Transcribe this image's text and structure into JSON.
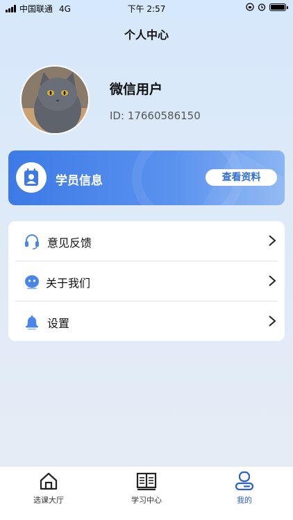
{
  "status_bar": {
    "carrier": "中国联通",
    "network": "4G",
    "time": "下午 2:57"
  },
  "header": {
    "title": "个人中心"
  },
  "profile": {
    "name": "微信用户",
    "id_text": "ID: 17660586150",
    "avatar_icon": "cat-photo"
  },
  "info_card": {
    "icon": "contact-card-icon",
    "title": "学员信息",
    "button_label": "查看资料",
    "accent": "#3d7ae6"
  },
  "menu": {
    "items": [
      {
        "icon": "headset-icon",
        "label": "意见反馈"
      },
      {
        "icon": "robot-face-icon",
        "label": "关于我们"
      },
      {
        "icon": "bell-icon",
        "label": "设置"
      }
    ]
  },
  "tab_bar": {
    "tabs": [
      {
        "icon": "house-icon",
        "label": "选课大厅",
        "active": false
      },
      {
        "icon": "book-icon",
        "label": "学习中心",
        "active": false
      },
      {
        "icon": "profile-icon",
        "label": "我的",
        "active": true
      }
    ],
    "active_color": "#2b5fd0"
  }
}
